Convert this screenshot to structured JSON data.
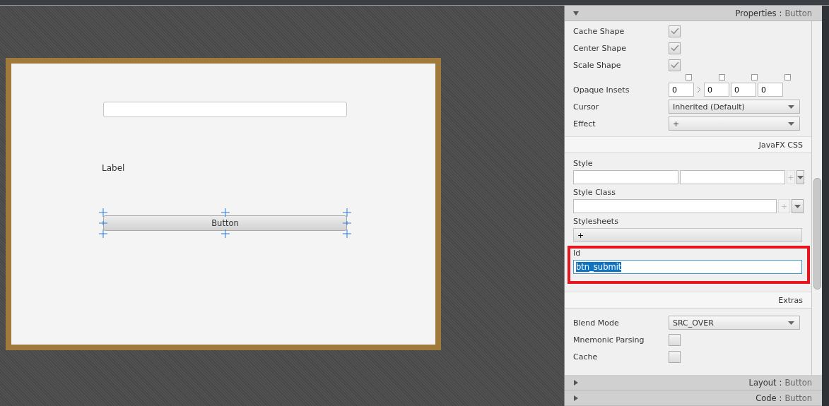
{
  "canvas": {
    "text_field": {
      "kind": "empty"
    },
    "label": "Label",
    "button": {
      "label": "Button",
      "selected": true
    }
  },
  "properties": {
    "title": "Properties",
    "separator": ":",
    "target": "Button",
    "expanded": true,
    "groups": [
      {
        "rows": [
          {
            "kind": "checkbox",
            "label": "Cache Shape",
            "checked": true
          },
          {
            "kind": "checkbox",
            "label": "Center Shape",
            "checked": true
          },
          {
            "kind": "checkbox",
            "label": "Scale Shape",
            "checked": true
          },
          {
            "kind": "insets",
            "label": "Opaque Insets",
            "values": [
              "0",
              "0",
              "0",
              "0"
            ]
          },
          {
            "kind": "select",
            "label": "Cursor",
            "value": "Inherited (Default)"
          },
          {
            "kind": "select",
            "label": "Effect",
            "value": "+"
          }
        ]
      },
      {
        "section": "JavaFX CSS",
        "rows": [
          {
            "kind": "style",
            "label": "Style",
            "plus": "+"
          },
          {
            "kind": "styleclass",
            "label": "Style Class",
            "plus": "+"
          },
          {
            "kind": "list",
            "label": "Stylesheets",
            "value": "+"
          },
          {
            "kind": "text",
            "label": "Id",
            "value": "btn_submit",
            "highlighted": true
          }
        ]
      },
      {
        "section": "Extras",
        "rows": [
          {
            "kind": "select",
            "label": "Blend Mode",
            "value": "SRC_OVER"
          },
          {
            "kind": "checkbox",
            "label": "Mnemonic Parsing",
            "checked": false
          },
          {
            "kind": "checkbox",
            "label": "Cache",
            "checked": false
          }
        ]
      }
    ]
  },
  "collapsed_panels": [
    {
      "title": "Layout",
      "separator": ":",
      "target": "Button",
      "expanded": false
    },
    {
      "title": "Code",
      "separator": ":",
      "target": "Button",
      "expanded": false
    }
  ]
}
